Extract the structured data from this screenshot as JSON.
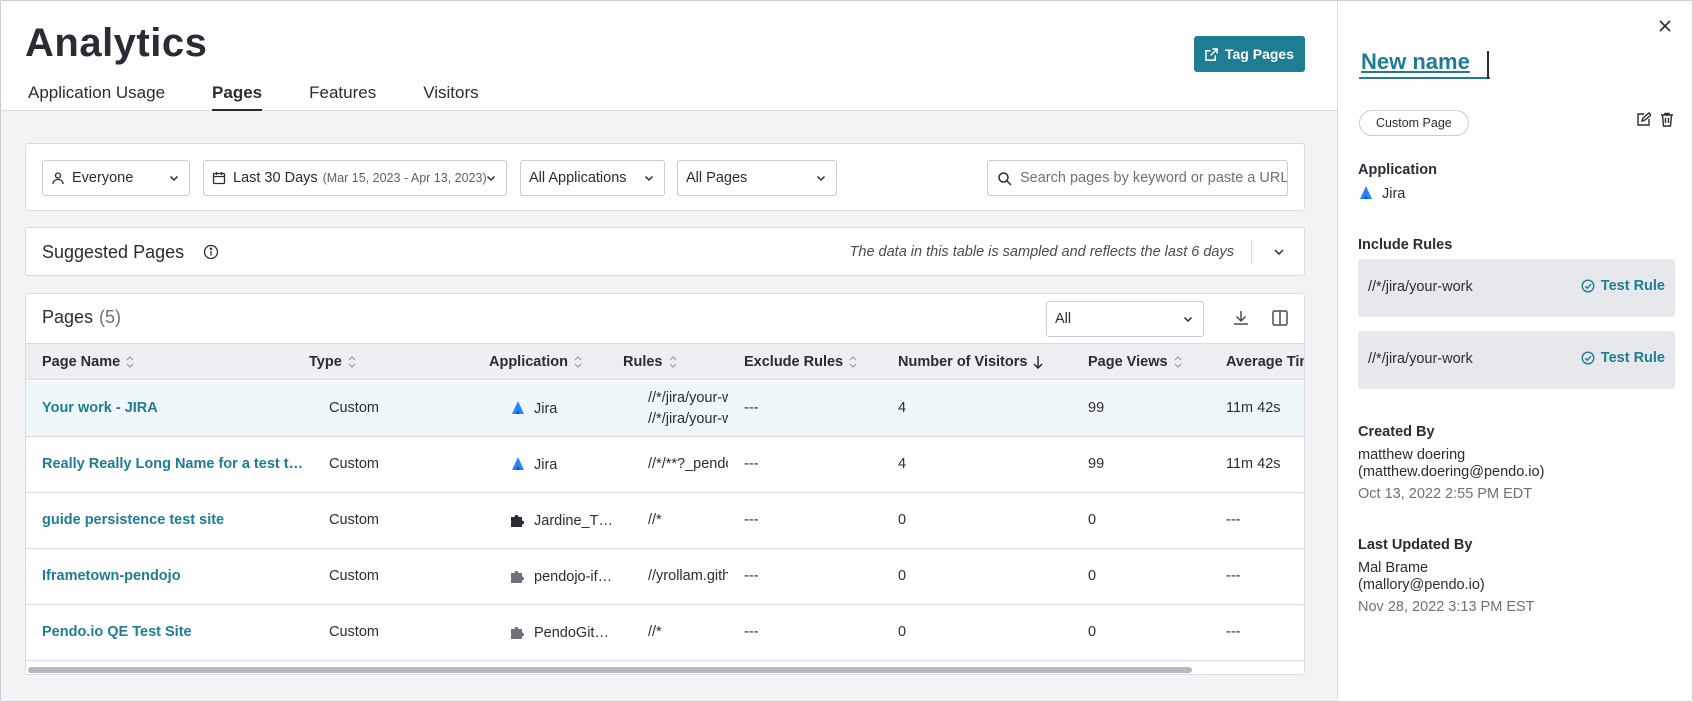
{
  "header": {
    "title": "Analytics",
    "tabs": [
      {
        "label": "Application Usage"
      },
      {
        "label": "Pages"
      },
      {
        "label": "Features"
      },
      {
        "label": "Visitors"
      }
    ],
    "tag_button": "Tag Pages"
  },
  "filters": {
    "segment": "Everyone",
    "date_range": "Last 30 Days",
    "date_detail": "(Mar 15, 2023 - Apr 13, 2023)",
    "applications": "All Applications",
    "pages": "All Pages",
    "search_placeholder": "Search pages by keyword or paste a URL"
  },
  "suggested": {
    "title": "Suggested Pages",
    "note": "The data in this table is sampled and reflects the last 6 days"
  },
  "pages_table": {
    "title": "Pages",
    "count": "(5)",
    "filter_value": "All",
    "columns": [
      "Page Name",
      "Type",
      "Application",
      "Rules",
      "Exclude Rules",
      "Number of Visitors",
      "Page Views",
      "Average Time"
    ],
    "rows": [
      {
        "name": "Your work - JIRA",
        "type": "Custom",
        "app": "Jira",
        "app_icon": "jira-icon",
        "rules": [
          "//*/jira/your-work",
          "//*/jira/your-work"
        ],
        "exclude": "---",
        "visitors": "4",
        "views": "99",
        "avg": "11m 42s"
      },
      {
        "name": "Really Really Long Name for a test t…",
        "type": "Custom",
        "app": "Jira",
        "app_icon": "jira-icon",
        "rules": [
          "//*/**?_pendo"
        ],
        "exclude": "---",
        "visitors": "4",
        "views": "99",
        "avg": "11m 42s"
      },
      {
        "name": "guide persistence test site",
        "type": "Custom",
        "app": "Jardine_T…",
        "app_icon": "puzzle-icon",
        "rules": [
          "//*"
        ],
        "exclude": "---",
        "visitors": "0",
        "views": "0",
        "avg": "---"
      },
      {
        "name": "Iframetown-pendojo",
        "type": "Custom",
        "app": "pendojo-if…",
        "app_icon": "puzzle-icon",
        "rules": [
          "//yrollam.github"
        ],
        "exclude": "---",
        "visitors": "0",
        "views": "0",
        "avg": "---"
      },
      {
        "name": "Pendo.io QE Test Site",
        "type": "Custom",
        "app": "PendoGit…",
        "app_icon": "puzzle-icon",
        "rules": [
          "//*"
        ],
        "exclude": "---",
        "visitors": "0",
        "views": "0",
        "avg": "---"
      }
    ]
  },
  "panel": {
    "name_value": "New name",
    "badge": "Custom Page",
    "application_label": "Application",
    "application_value": "Jira",
    "include_rules_label": "Include Rules",
    "rules": [
      {
        "text": "//*/jira/your-work",
        "button": "Test Rule"
      },
      {
        "text": "//*/jira/your-work",
        "button": "Test Rule"
      }
    ],
    "created_by_label": "Created By",
    "created_by_name": "matthew doering",
    "created_by_email": "(matthew.doering@pendo.io)",
    "created_at": "Oct 13, 2022 2:55 PM EDT",
    "updated_by_label": "Last Updated By",
    "updated_by_name": "Mal Brame",
    "updated_by_email": "(mallory@pendo.io)",
    "updated_at": "Nov 28, 2022 3:13 PM EST"
  },
  "colors": {
    "accent": "#1e7c93",
    "jira_blue": "#2684ff"
  }
}
